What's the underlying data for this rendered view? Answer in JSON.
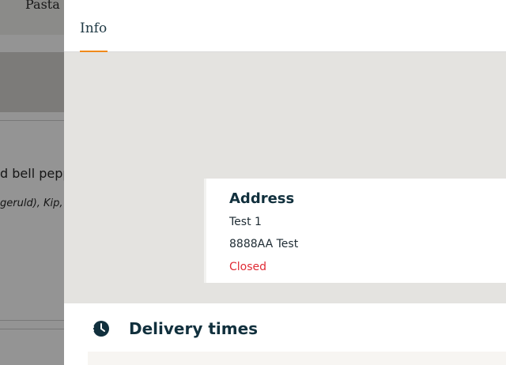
{
  "background": {
    "tab_label": "Pasta",
    "product_description": "d bell pepp",
    "ingredients": "geruld), Kip, "
  },
  "drawer": {
    "tabs": [
      {
        "label": "Info",
        "active": true
      }
    ],
    "address": {
      "title": "Address",
      "line1": "Test 1",
      "line2": "8888AA Test",
      "status": "Closed"
    },
    "delivery": {
      "title": "Delivery times",
      "icon": "clock-icon"
    }
  },
  "colors": {
    "accent": "#f08a1c",
    "heading": "#11303d",
    "closed": "#e02b35",
    "map": "#e4e3e0"
  }
}
